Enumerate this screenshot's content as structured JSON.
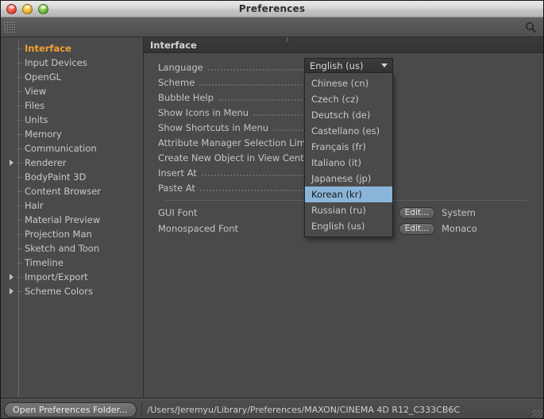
{
  "window": {
    "title": "Preferences",
    "traffic_lights": [
      "close-button",
      "minimize-button",
      "zoom-button"
    ]
  },
  "search": {
    "value": "",
    "placeholder": "",
    "icon": "search-icon"
  },
  "sidebar": {
    "items": [
      {
        "label": "Interface",
        "selected": true,
        "expandable": false
      },
      {
        "label": "Input Devices",
        "selected": false,
        "expandable": false
      },
      {
        "label": "OpenGL",
        "selected": false,
        "expandable": false
      },
      {
        "label": "View",
        "selected": false,
        "expandable": false
      },
      {
        "label": "Files",
        "selected": false,
        "expandable": false
      },
      {
        "label": "Units",
        "selected": false,
        "expandable": false
      },
      {
        "label": "Memory",
        "selected": false,
        "expandable": false
      },
      {
        "label": "Communication",
        "selected": false,
        "expandable": false
      },
      {
        "label": "Renderer",
        "selected": false,
        "expandable": true
      },
      {
        "label": "BodyPaint 3D",
        "selected": false,
        "expandable": false
      },
      {
        "label": "Content Browser",
        "selected": false,
        "expandable": false
      },
      {
        "label": "Hair",
        "selected": false,
        "expandable": false
      },
      {
        "label": "Material Preview",
        "selected": false,
        "expandable": false
      },
      {
        "label": "Projection Man",
        "selected": false,
        "expandable": false
      },
      {
        "label": "Sketch and Toon",
        "selected": false,
        "expandable": false
      },
      {
        "label": "Timeline",
        "selected": false,
        "expandable": false
      },
      {
        "label": "Import/Export",
        "selected": false,
        "expandable": true
      },
      {
        "label": "Scheme Colors",
        "selected": false,
        "expandable": true
      }
    ]
  },
  "main": {
    "header": "Interface",
    "rows": [
      {
        "label": "Language"
      },
      {
        "label": "Scheme"
      },
      {
        "label": "Bubble Help"
      },
      {
        "label": "Show Icons in Menu"
      },
      {
        "label": "Show Shortcuts in Menu"
      },
      {
        "label": "Attribute Manager Selection Limit"
      },
      {
        "label": "Create New Object in View Center"
      },
      {
        "label": "Insert At"
      },
      {
        "label": "Paste At"
      }
    ],
    "font_rows": [
      {
        "label": "GUI Font",
        "button": "Edit...",
        "value": "System"
      },
      {
        "label": "Monospaced Font",
        "button": "Edit...",
        "value": "Monaco"
      }
    ]
  },
  "language_dropdown": {
    "selected": "English (us)",
    "highlighted": "Korean (kr)",
    "highlight_color": "#8ab4d8",
    "options": [
      "Chinese (cn)",
      "Czech (cz)",
      "Deutsch (de)",
      "Castellano (es)",
      "Français (fr)",
      "Italiano (it)",
      "Japanese (jp)",
      "Korean (kr)",
      "Russian (ru)",
      "English (us)"
    ]
  },
  "bottom": {
    "button": "Open Preferences Folder...",
    "path": "/Users/Jeremyu/Library/Preferences/MAXON/CINEMA 4D R12_C333CB6C"
  },
  "colors": {
    "selected_nav": "#f0a030",
    "panel_bg": "#4a4a4a",
    "highlight": "#8ab4d8"
  }
}
